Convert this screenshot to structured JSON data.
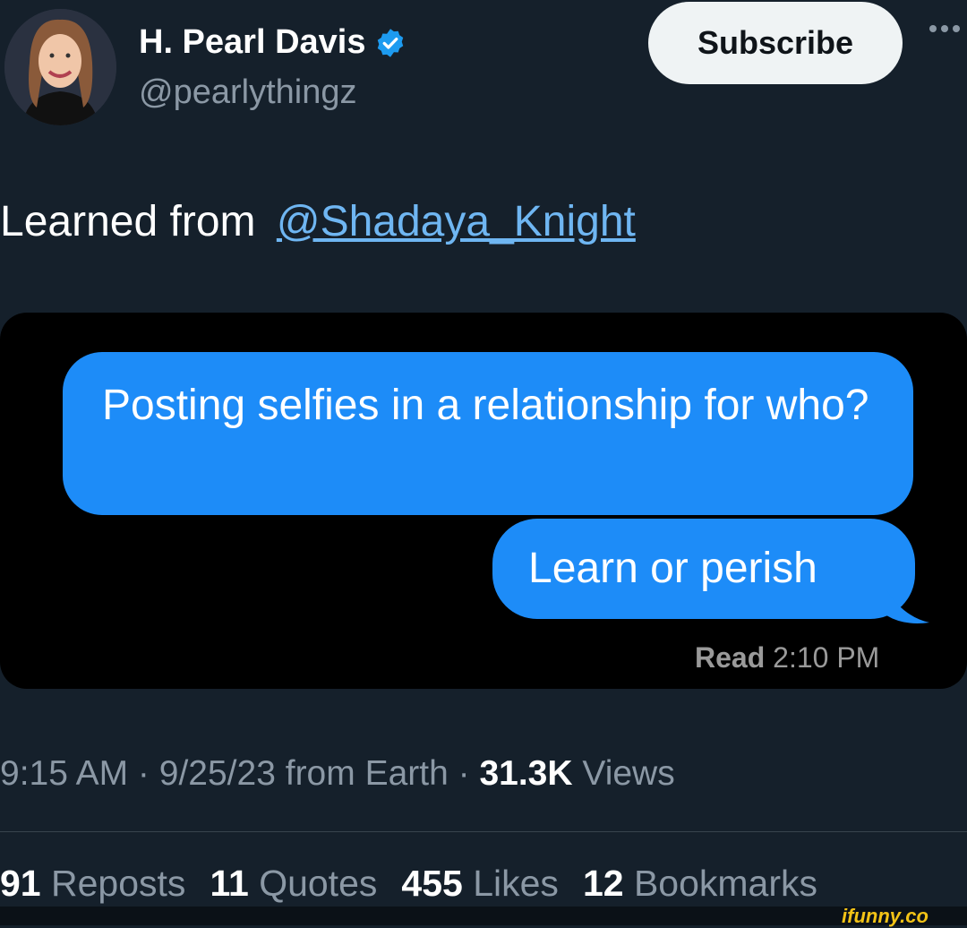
{
  "author": {
    "name": "H. Pearl Davis",
    "handle": "@pearlythingz",
    "verified_icon": "verified-badge-icon",
    "avatar": "avatar-photo"
  },
  "header": {
    "subscribe_label": "Subscribe",
    "more_icon": "more-options-icon"
  },
  "tweet": {
    "text_prefix": "Learned from",
    "mention": "@Shadaya_Knight"
  },
  "media": {
    "bubble_1": "Posting selfies in a relationship for who?",
    "bubble_2": "Learn or perish",
    "read_label": "Read",
    "read_time": "2:10 PM"
  },
  "meta": {
    "time": "9:15 AM",
    "date": "9/25/23",
    "source": "from Earth",
    "views_count": "31.3K",
    "views_label": "Views"
  },
  "stats": [
    {
      "count": "91",
      "label": "Reposts"
    },
    {
      "count": "11",
      "label": "Quotes"
    },
    {
      "count": "455",
      "label": "Likes"
    },
    {
      "count": "12",
      "label": "Bookmarks"
    }
  ],
  "watermark": "ifunny.co",
  "colors": {
    "background": "#15202b",
    "bubble": "#1d8cf8",
    "link": "#6fb6f2",
    "muted": "#8b98a5"
  }
}
